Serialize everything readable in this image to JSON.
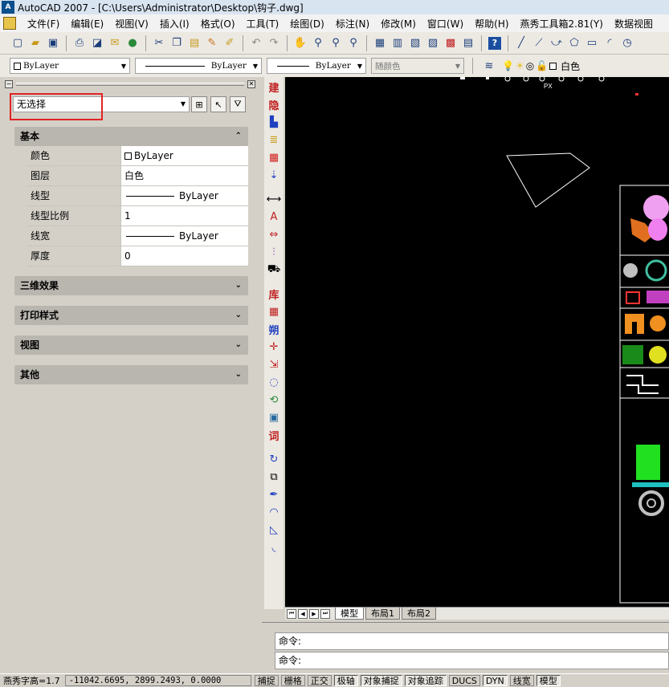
{
  "window": {
    "title": "AutoCAD 2007 - [C:\\Users\\Administrator\\Desktop\\钩子.dwg]"
  },
  "menu": {
    "items": [
      "文件(F)",
      "编辑(E)",
      "视图(V)",
      "插入(I)",
      "格式(O)",
      "工具(T)",
      "绘图(D)",
      "标注(N)",
      "修改(M)",
      "窗口(W)",
      "帮助(H)",
      "燕秀工具箱2.81(Y)",
      "数据视图"
    ]
  },
  "layerbar": {
    "color": "ByLayer",
    "linetype": "ByLayer",
    "lineweight": "ByLayer",
    "plotstyle": "随颜色",
    "layer": "白色"
  },
  "properties": {
    "selection": "无选择",
    "sections": [
      "基本",
      "三维效果",
      "打印样式",
      "视图",
      "其他"
    ],
    "rows": [
      {
        "name": "颜色",
        "value": "ByLayer"
      },
      {
        "name": "图层",
        "value": "白色"
      },
      {
        "name": "线型",
        "value": "ByLayer"
      },
      {
        "name": "线型比例",
        "value": "1"
      },
      {
        "name": "线宽",
        "value": "ByLayer"
      },
      {
        "name": "厚度",
        "value": "0"
      }
    ]
  },
  "vtoolbar": {
    "labels": [
      "建",
      "隐",
      "库",
      "朔",
      "词"
    ]
  },
  "drawing": {
    "tag": "PX"
  },
  "layouts": {
    "tabs": [
      "模型",
      "布局1",
      "布局2"
    ]
  },
  "command": {
    "prompt1": "命令:",
    "prompt2": "命令:"
  },
  "status": {
    "text_height": "燕秀字高=1.7",
    "coords": "-11042.6695, 2899.2493, 0.0000",
    "buttons": [
      "捕捉",
      "栅格",
      "正交",
      "极轴",
      "对象捕捉",
      "对象追踪",
      "DUCS",
      "DYN",
      "线宽",
      "模型"
    ]
  },
  "colors": {
    "accent_red": "#e02424",
    "canvas": "#000000"
  }
}
